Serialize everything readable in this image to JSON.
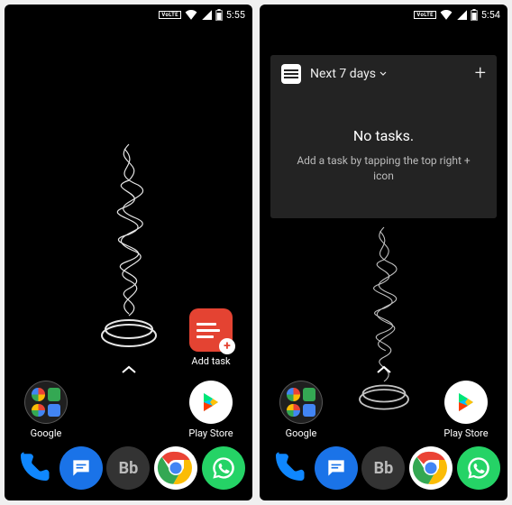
{
  "left": {
    "status": {
      "network": "VoLTE",
      "time": "5:55"
    },
    "shortcut": {
      "label": "Add task"
    },
    "folder": {
      "label": "Google"
    },
    "playstore": {
      "label": "Play Store"
    }
  },
  "right": {
    "status": {
      "network": "VoLTE",
      "time": "5:54"
    },
    "widget": {
      "title": "Next 7 days",
      "empty_headline": "No tasks.",
      "empty_sub": "Add a task by tapping the top right + icon"
    },
    "folder": {
      "label": "Google"
    },
    "playstore": {
      "label": "Play Store"
    }
  },
  "dock": {
    "bb_label": "Bb"
  }
}
